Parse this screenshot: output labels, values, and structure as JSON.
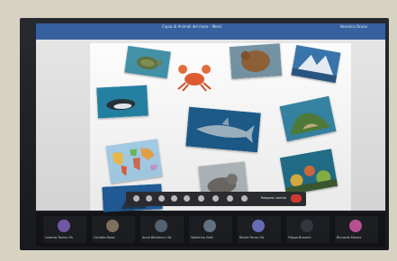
{
  "window": {
    "title": "Copia di Animali del mare - Word",
    "user": "Veronica Bruno"
  },
  "toolbar": {
    "request_control_label": "Request control"
  },
  "participants": [
    {
      "name": "Lorenzo Tonino 5A",
      "color": "#7a5fb5"
    },
    {
      "name": "Carlotta Rossi",
      "color": "#8a7a66"
    },
    {
      "name": "Anna Bertolucci 5A",
      "color": "#5a6a7a"
    },
    {
      "name": "Valentina Galli",
      "color": "#6b7b8b"
    },
    {
      "name": "Nicolò Penzo 5A",
      "color": "#6f74c9"
    },
    {
      "name": "Filippo Brioschi",
      "color": "#3a3a44"
    },
    {
      "name": "Riccardo Marino",
      "color": "#c7569f"
    }
  ]
}
